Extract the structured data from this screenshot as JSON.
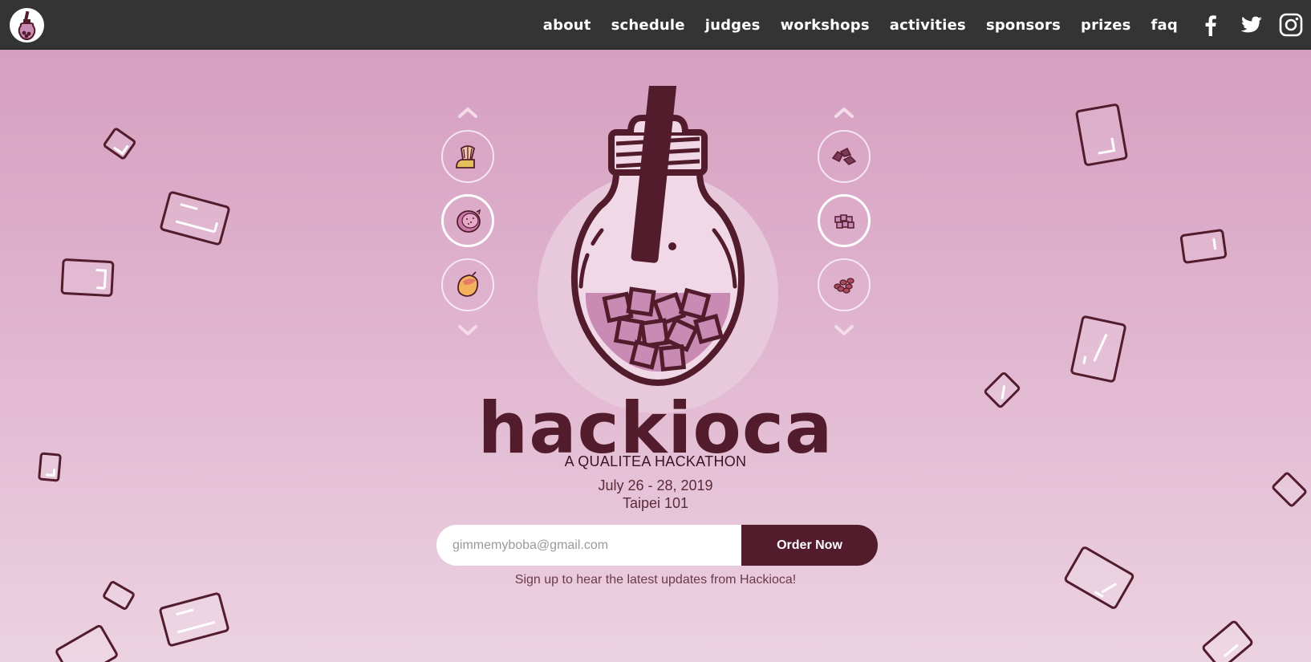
{
  "nav": {
    "logo": "boba-bulb-logo",
    "links": [
      "about",
      "schedule",
      "judges",
      "workshops",
      "activities",
      "sponsors",
      "prizes",
      "faq"
    ],
    "social": [
      "facebook-icon",
      "twitter-icon",
      "instagram-icon"
    ]
  },
  "hero": {
    "title": "hackioca",
    "subtitle": "A QUALITEA HACKATHON",
    "date": "July 26 - 28, 2019",
    "venue": "Taipei 101"
  },
  "left_selector": {
    "items": [
      "seashell-icon",
      "dragonfruit-icon",
      "mango-icon"
    ],
    "active_index": 1
  },
  "right_selector": {
    "items": [
      "grass-jelly-icon",
      "jelly-cubes-icon",
      "red-beans-icon"
    ],
    "active_index": 1
  },
  "signup": {
    "placeholder": "gimmemyboba@gmail.com",
    "button_label": "Order Now",
    "note": "Sign up to hear the latest updates from Hackioca!"
  },
  "colors": {
    "nav_bg": "#343434",
    "accent": "#521c2c",
    "bg_top": "#d49bbd",
    "bg_bottom": "#ecd2e1",
    "bulb_fill": "#c98bb3",
    "circle": "#e8c9dc"
  }
}
